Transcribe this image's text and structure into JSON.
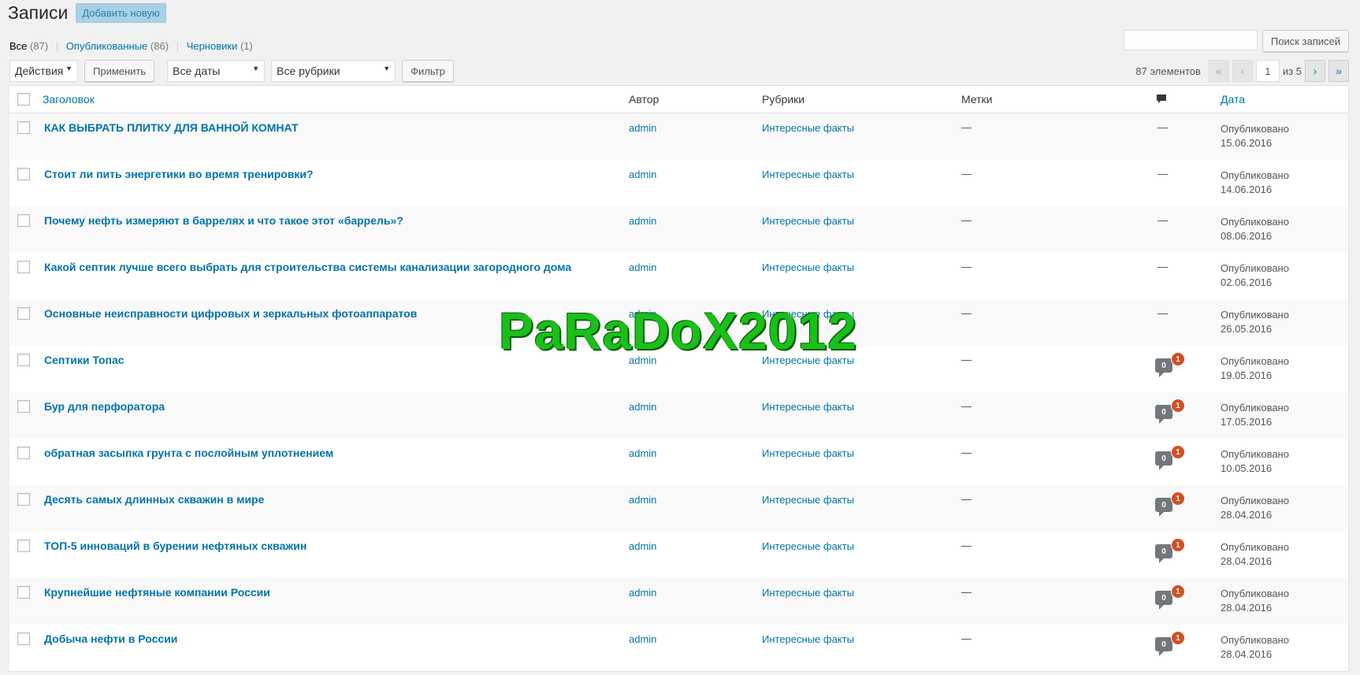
{
  "header": {
    "title": "Записи",
    "add_new_label": "Добавить новую"
  },
  "views": {
    "all_label": "Все",
    "all_count": "(87)",
    "published_label": "Опубликованные",
    "published_count": "(86)",
    "drafts_label": "Черновики",
    "drafts_count": "(1)",
    "separator": "|"
  },
  "search": {
    "value": "",
    "button_label": "Поиск записей"
  },
  "tablenav": {
    "bulk_actions": "Действия",
    "apply_label": "Применить",
    "dates": "Все даты",
    "categories": "Все рубрики",
    "filter_label": "Фильтр"
  },
  "pagination": {
    "items_label": "87 элементов",
    "first": "«",
    "prev": "‹",
    "current_page": "1",
    "of_label": "из 5",
    "next": "›",
    "last": "»"
  },
  "table": {
    "columns": {
      "title": "Заголовок",
      "author": "Автор",
      "categories": "Рубрики",
      "tags": "Метки",
      "comments_icon": "comment-bubble-icon",
      "date": "Дата"
    },
    "rows": [
      {
        "title": "КАК ВЫБРАТЬ ПЛИТКУ ДЛЯ ВАННОЙ КОМНАТ",
        "author": "admin",
        "category": "Интересные факты",
        "tags": "—",
        "comments": "—",
        "status": "Опубликовано",
        "date": "15.06.2016"
      },
      {
        "title": "Стоит ли пить энергетики во время тренировки?",
        "author": "admin",
        "category": "Интересные факты",
        "tags": "—",
        "comments": "—",
        "status": "Опубликовано",
        "date": "14.06.2016"
      },
      {
        "title": "Почему нефть измеряют в баррелях и что такое этот «баррель»?",
        "author": "admin",
        "category": "Интересные факты",
        "tags": "—",
        "comments": "—",
        "status": "Опубликовано",
        "date": "08.06.2016"
      },
      {
        "title": "Какой септик лучше всего выбрать для строительства системы канализации загородного дома",
        "author": "admin",
        "category": "Интересные факты",
        "tags": "—",
        "comments": "—",
        "status": "Опубликовано",
        "date": "02.06.2016"
      },
      {
        "title": "Основные неисправности цифровых и зеркальных фотоаппаратов",
        "author": "admin",
        "category": "Интересные факты",
        "tags": "—",
        "comments": "—",
        "status": "Опубликовано",
        "date": "26.05.2016"
      },
      {
        "title": "Септики Топас",
        "author": "admin",
        "category": "Интересные факты",
        "tags": "—",
        "comments_approved": "0",
        "comments_pending": "1",
        "status": "Опубликовано",
        "date": "19.05.2016"
      },
      {
        "title": "Бур для перфоратора",
        "author": "admin",
        "category": "Интересные факты",
        "tags": "—",
        "comments_approved": "0",
        "comments_pending": "1",
        "status": "Опубликовано",
        "date": "17.05.2016"
      },
      {
        "title": "обратная засыпка грунта с послойным уплотнением",
        "author": "admin",
        "category": "Интересные факты",
        "tags": "—",
        "comments_approved": "0",
        "comments_pending": "1",
        "status": "Опубликовано",
        "date": "10.05.2016"
      },
      {
        "title": "Десять самых длинных скважин в мире",
        "author": "admin",
        "category": "Интересные факты",
        "tags": "—",
        "comments_approved": "0",
        "comments_pending": "1",
        "status": "Опубликовано",
        "date": "28.04.2016"
      },
      {
        "title": "ТОП-5 инноваций в бурении нефтяных скважин",
        "author": "admin",
        "category": "Интересные факты",
        "tags": "—",
        "comments_approved": "0",
        "comments_pending": "1",
        "status": "Опубликовано",
        "date": "28.04.2016"
      },
      {
        "title": "Крупнейшие нефтяные компании России",
        "author": "admin",
        "category": "Интересные факты",
        "tags": "—",
        "comments_approved": "0",
        "comments_pending": "1",
        "status": "Опубликовано",
        "date": "28.04.2016"
      },
      {
        "title": "Добыча нефти в России",
        "author": "admin",
        "category": "Интересные факты",
        "tags": "—",
        "comments_approved": "0",
        "comments_pending": "1",
        "status": "Опубликовано",
        "date": "28.04.2016"
      }
    ]
  },
  "watermark": "PaRaDoX2012",
  "colors": {
    "link": "#0073aa",
    "pending_badge": "#d54e21",
    "count_bubble": "#72777c",
    "watermark": "#18c018"
  }
}
